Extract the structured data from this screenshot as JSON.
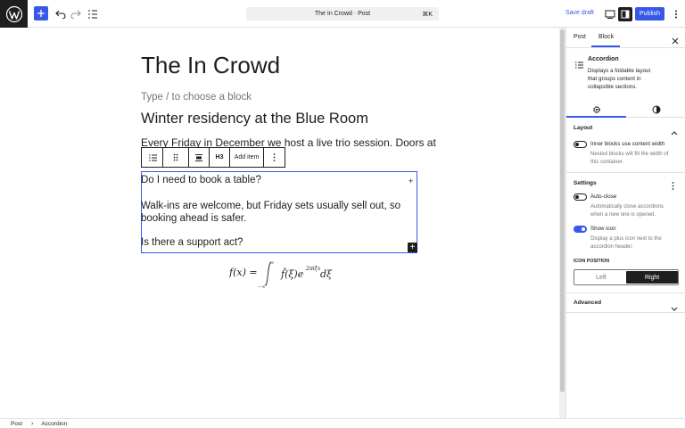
{
  "topbar": {
    "document_title": "The In Crowd · Post",
    "shortcut": "⌘K",
    "save_draft_label": "Save draft",
    "publish_label": "Publish"
  },
  "editor": {
    "post_title": "The In Crowd",
    "placeholder": "Type / to choose a block",
    "heading": "Winter residency at the Blue Room",
    "paragraph": "Every Friday in December we host a live trio session. Doors at",
    "toolbar": {
      "heading_level": "H3",
      "add_item_label": "Add item"
    },
    "accordion_items": [
      {
        "text": "Do I need to book a table?"
      },
      {
        "text": "Walk-ins are welcome, but Friday sets usually sell out, so booking ahead is safer."
      },
      {
        "text": "Is there a support act?"
      }
    ]
  },
  "breadcrumb": {
    "items": [
      "Post",
      "Accordion"
    ]
  },
  "sidebar": {
    "tabs": [
      "Post",
      "Block"
    ],
    "active_tab": "Block",
    "block": {
      "name": "Accordion",
      "description": "Displays a foldable layout that groups content in collapsible sections."
    },
    "layout": {
      "title": "Layout",
      "inner_blocks_label": "Inner blocks use content width",
      "inner_blocks_on": false,
      "inner_blocks_help": "Nested blocks will fill the width of this container."
    },
    "settings": {
      "title": "Settings",
      "auto_close_label": "Auto-close",
      "auto_close_on": false,
      "auto_close_help": "Automatically close accordions when a new one is opened.",
      "show_icon_label": "Show icon",
      "show_icon_on": true,
      "show_icon_help": "Display a plus icon next to the accordion header.",
      "icon_position_label": "ICON POSITION",
      "icon_position_options": [
        "Left",
        "Right"
      ],
      "icon_position_selected": "Right"
    },
    "advanced_label": "Advanced"
  },
  "colors": {
    "accent": "#3858e9",
    "text": "#1e1e1e",
    "muted": "#757575"
  }
}
